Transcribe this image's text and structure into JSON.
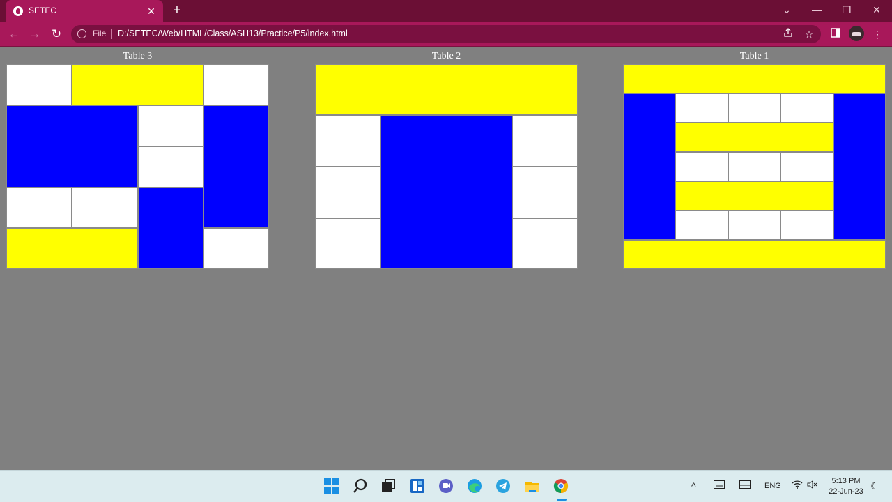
{
  "browser": {
    "tab_title": "SETEC",
    "tab_close": "✕",
    "new_tab": "+",
    "window_controls": {
      "minimize": "—",
      "maximize": "❐",
      "close": "✕",
      "tab_search": "⌄"
    },
    "back": "←",
    "forward": "→",
    "reload": "↻",
    "address_file_label": "File",
    "address_url": "D:/SETEC/Web/HTML/Class/ASH13/Practice/P5/index.html",
    "icons": [
      "info-icon",
      "share-icon",
      "star-icon",
      "side-panel-icon",
      "profile-avatar",
      "more-menu-icon"
    ]
  },
  "colors": {
    "tab_bar": "#6b0f35",
    "toolbar": "#a8185a",
    "page_bg": "#808080",
    "white": "#ffffff",
    "yellow": "#ffff00",
    "blue": "#0000ff"
  },
  "tables": [
    {
      "caption": "Table 3",
      "grid": "4 columns x 5 rows",
      "cells": [
        {
          "color": "white",
          "row": 1,
          "col": 1,
          "rowspan": 1,
          "colspan": 1
        },
        {
          "color": "yellow",
          "row": 1,
          "col": 2,
          "rowspan": 1,
          "colspan": 2
        },
        {
          "color": "white",
          "row": 1,
          "col": 4,
          "rowspan": 1,
          "colspan": 1
        },
        {
          "color": "blue",
          "row": 2,
          "col": 1,
          "rowspan": 2,
          "colspan": 2
        },
        {
          "color": "white",
          "row": 2,
          "col": 3,
          "rowspan": 1,
          "colspan": 1
        },
        {
          "color": "blue",
          "row": 2,
          "col": 4,
          "rowspan": 3,
          "colspan": 1
        },
        {
          "color": "white",
          "row": 3,
          "col": 3,
          "rowspan": 1,
          "colspan": 1
        },
        {
          "color": "white",
          "row": 4,
          "col": 1,
          "rowspan": 1,
          "colspan": 1
        },
        {
          "color": "white",
          "row": 4,
          "col": 2,
          "rowspan": 1,
          "colspan": 1
        },
        {
          "color": "blue",
          "row": 4,
          "col": 3,
          "rowspan": 2,
          "colspan": 1
        },
        {
          "color": "yellow",
          "row": 5,
          "col": 1,
          "rowspan": 1,
          "colspan": 2
        },
        {
          "color": "white",
          "row": 5,
          "col": 4,
          "rowspan": 1,
          "colspan": 1
        }
      ]
    },
    {
      "caption": "Table 2",
      "grid": "4 columns x 4 rows",
      "cells": [
        {
          "color": "yellow",
          "row": 1,
          "col": 1,
          "rowspan": 1,
          "colspan": 4
        },
        {
          "color": "white",
          "row": 2,
          "col": 1,
          "rowspan": 1,
          "colspan": 1
        },
        {
          "color": "blue",
          "row": 2,
          "col": 2,
          "rowspan": 3,
          "colspan": 2
        },
        {
          "color": "white",
          "row": 2,
          "col": 4,
          "rowspan": 1,
          "colspan": 1
        },
        {
          "color": "white",
          "row": 3,
          "col": 1,
          "rowspan": 1,
          "colspan": 1
        },
        {
          "color": "white",
          "row": 3,
          "col": 4,
          "rowspan": 1,
          "colspan": 1
        },
        {
          "color": "white",
          "row": 4,
          "col": 1,
          "rowspan": 1,
          "colspan": 1
        },
        {
          "color": "white",
          "row": 4,
          "col": 4,
          "rowspan": 1,
          "colspan": 1
        }
      ]
    },
    {
      "caption": "Table 1",
      "grid": "5 columns x 7 rows",
      "cells": [
        {
          "color": "yellow",
          "row": 1,
          "col": 1,
          "rowspan": 1,
          "colspan": 5
        },
        {
          "color": "blue",
          "row": 2,
          "col": 1,
          "rowspan": 5,
          "colspan": 1
        },
        {
          "color": "white",
          "row": 2,
          "col": 2,
          "rowspan": 1,
          "colspan": 1
        },
        {
          "color": "white",
          "row": 2,
          "col": 3,
          "rowspan": 1,
          "colspan": 1
        },
        {
          "color": "white",
          "row": 2,
          "col": 4,
          "rowspan": 1,
          "colspan": 1
        },
        {
          "color": "blue",
          "row": 2,
          "col": 5,
          "rowspan": 5,
          "colspan": 1
        },
        {
          "color": "yellow",
          "row": 3,
          "col": 2,
          "rowspan": 1,
          "colspan": 3
        },
        {
          "color": "white",
          "row": 4,
          "col": 2,
          "rowspan": 1,
          "colspan": 1
        },
        {
          "color": "white",
          "row": 4,
          "col": 3,
          "rowspan": 1,
          "colspan": 1
        },
        {
          "color": "white",
          "row": 4,
          "col": 4,
          "rowspan": 1,
          "colspan": 1
        },
        {
          "color": "yellow",
          "row": 5,
          "col": 2,
          "rowspan": 1,
          "colspan": 3
        },
        {
          "color": "white",
          "row": 6,
          "col": 2,
          "rowspan": 1,
          "colspan": 1
        },
        {
          "color": "white",
          "row": 6,
          "col": 3,
          "rowspan": 1,
          "colspan": 1
        },
        {
          "color": "white",
          "row": 6,
          "col": 4,
          "rowspan": 1,
          "colspan": 1
        },
        {
          "color": "yellow",
          "row": 7,
          "col": 1,
          "rowspan": 1,
          "colspan": 5
        }
      ]
    }
  ],
  "taskbar": {
    "apps": [
      "windows-start-icon",
      "search-icon",
      "task-view-icon",
      "widgets-icon",
      "teams-chat-icon",
      "edge-icon",
      "telegram-icon",
      "file-explorer-icon",
      "chrome-icon"
    ],
    "tray_chevron": "^",
    "language": "ENG",
    "time": "5:13 PM",
    "date": "22-Jun-23"
  }
}
